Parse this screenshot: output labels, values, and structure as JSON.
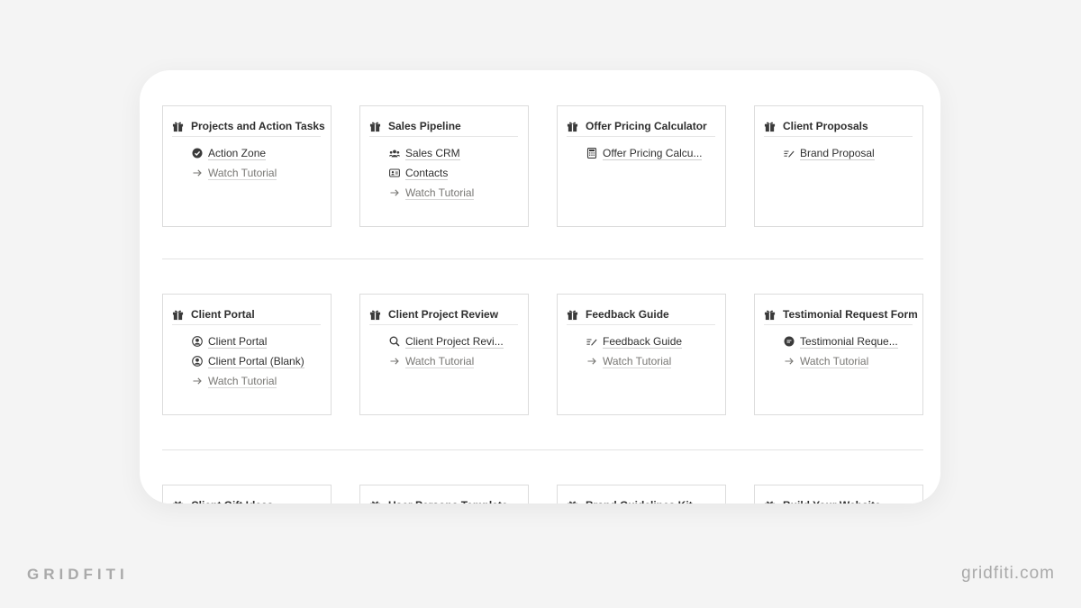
{
  "cards": [
    {
      "title": "Projects and Action Tasks",
      "items": [
        {
          "icon": "check-circle-icon",
          "label": "Action Zone"
        },
        {
          "icon": "arrow-right-icon",
          "label": "Watch Tutorial",
          "tutorial": true
        }
      ]
    },
    {
      "title": "Sales Pipeline",
      "items": [
        {
          "icon": "people-icon",
          "label": "Sales CRM"
        },
        {
          "icon": "contact-card-icon",
          "label": "Contacts"
        },
        {
          "icon": "arrow-right-icon",
          "label": "Watch Tutorial",
          "tutorial": true
        }
      ]
    },
    {
      "title": "Offer Pricing Calculator",
      "items": [
        {
          "icon": "calculator-icon",
          "label": "Offer Pricing Calcu..."
        }
      ]
    },
    {
      "title": "Client Proposals",
      "items": [
        {
          "icon": "signature-icon",
          "label": "Brand Proposal"
        }
      ]
    },
    {
      "title": "Client Portal",
      "items": [
        {
          "icon": "user-circle-icon",
          "label": "Client Portal"
        },
        {
          "icon": "user-circle-icon",
          "label": "Client Portal (Blank)"
        },
        {
          "icon": "arrow-right-icon",
          "label": "Watch Tutorial",
          "tutorial": true
        }
      ]
    },
    {
      "title": "Client Project Review",
      "items": [
        {
          "icon": "search-icon",
          "label": "Client Project Revi..."
        },
        {
          "icon": "arrow-right-icon",
          "label": "Watch Tutorial",
          "tutorial": true
        }
      ]
    },
    {
      "title": "Feedback Guide",
      "items": [
        {
          "icon": "signature-icon",
          "label": "Feedback Guide"
        },
        {
          "icon": "arrow-right-icon",
          "label": "Watch Tutorial",
          "tutorial": true
        }
      ]
    },
    {
      "title": "Testimonial Request Form",
      "items": [
        {
          "icon": "chat-bubble-icon",
          "label": "Testimonial Reque..."
        },
        {
          "icon": "arrow-right-icon",
          "label": "Watch Tutorial",
          "tutorial": true
        }
      ]
    },
    {
      "title": "Client Gift Ideas",
      "items": []
    },
    {
      "title": "User Persona Template",
      "items": []
    },
    {
      "title": "Brand Guidelines Kit",
      "items": []
    },
    {
      "title": "Build Your Website",
      "items": []
    }
  ],
  "brand_left": "GRIDFITI",
  "brand_right": "gridfiti.com"
}
